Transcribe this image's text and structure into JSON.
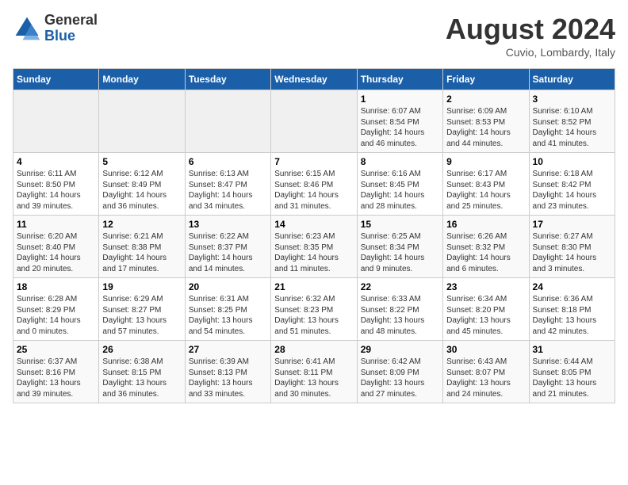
{
  "header": {
    "logo_general": "General",
    "logo_blue": "Blue",
    "month_title": "August 2024",
    "subtitle": "Cuvio, Lombardy, Italy"
  },
  "days_of_week": [
    "Sunday",
    "Monday",
    "Tuesday",
    "Wednesday",
    "Thursday",
    "Friday",
    "Saturday"
  ],
  "weeks": [
    [
      {
        "day": "",
        "info": ""
      },
      {
        "day": "",
        "info": ""
      },
      {
        "day": "",
        "info": ""
      },
      {
        "day": "",
        "info": ""
      },
      {
        "day": "1",
        "info": "Sunrise: 6:07 AM\nSunset: 8:54 PM\nDaylight: 14 hours and 46 minutes."
      },
      {
        "day": "2",
        "info": "Sunrise: 6:09 AM\nSunset: 8:53 PM\nDaylight: 14 hours and 44 minutes."
      },
      {
        "day": "3",
        "info": "Sunrise: 6:10 AM\nSunset: 8:52 PM\nDaylight: 14 hours and 41 minutes."
      }
    ],
    [
      {
        "day": "4",
        "info": "Sunrise: 6:11 AM\nSunset: 8:50 PM\nDaylight: 14 hours and 39 minutes."
      },
      {
        "day": "5",
        "info": "Sunrise: 6:12 AM\nSunset: 8:49 PM\nDaylight: 14 hours and 36 minutes."
      },
      {
        "day": "6",
        "info": "Sunrise: 6:13 AM\nSunset: 8:47 PM\nDaylight: 14 hours and 34 minutes."
      },
      {
        "day": "7",
        "info": "Sunrise: 6:15 AM\nSunset: 8:46 PM\nDaylight: 14 hours and 31 minutes."
      },
      {
        "day": "8",
        "info": "Sunrise: 6:16 AM\nSunset: 8:45 PM\nDaylight: 14 hours and 28 minutes."
      },
      {
        "day": "9",
        "info": "Sunrise: 6:17 AM\nSunset: 8:43 PM\nDaylight: 14 hours and 25 minutes."
      },
      {
        "day": "10",
        "info": "Sunrise: 6:18 AM\nSunset: 8:42 PM\nDaylight: 14 hours and 23 minutes."
      }
    ],
    [
      {
        "day": "11",
        "info": "Sunrise: 6:20 AM\nSunset: 8:40 PM\nDaylight: 14 hours and 20 minutes."
      },
      {
        "day": "12",
        "info": "Sunrise: 6:21 AM\nSunset: 8:38 PM\nDaylight: 14 hours and 17 minutes."
      },
      {
        "day": "13",
        "info": "Sunrise: 6:22 AM\nSunset: 8:37 PM\nDaylight: 14 hours and 14 minutes."
      },
      {
        "day": "14",
        "info": "Sunrise: 6:23 AM\nSunset: 8:35 PM\nDaylight: 14 hours and 11 minutes."
      },
      {
        "day": "15",
        "info": "Sunrise: 6:25 AM\nSunset: 8:34 PM\nDaylight: 14 hours and 9 minutes."
      },
      {
        "day": "16",
        "info": "Sunrise: 6:26 AM\nSunset: 8:32 PM\nDaylight: 14 hours and 6 minutes."
      },
      {
        "day": "17",
        "info": "Sunrise: 6:27 AM\nSunset: 8:30 PM\nDaylight: 14 hours and 3 minutes."
      }
    ],
    [
      {
        "day": "18",
        "info": "Sunrise: 6:28 AM\nSunset: 8:29 PM\nDaylight: 14 hours and 0 minutes."
      },
      {
        "day": "19",
        "info": "Sunrise: 6:29 AM\nSunset: 8:27 PM\nDaylight: 13 hours and 57 minutes."
      },
      {
        "day": "20",
        "info": "Sunrise: 6:31 AM\nSunset: 8:25 PM\nDaylight: 13 hours and 54 minutes."
      },
      {
        "day": "21",
        "info": "Sunrise: 6:32 AM\nSunset: 8:23 PM\nDaylight: 13 hours and 51 minutes."
      },
      {
        "day": "22",
        "info": "Sunrise: 6:33 AM\nSunset: 8:22 PM\nDaylight: 13 hours and 48 minutes."
      },
      {
        "day": "23",
        "info": "Sunrise: 6:34 AM\nSunset: 8:20 PM\nDaylight: 13 hours and 45 minutes."
      },
      {
        "day": "24",
        "info": "Sunrise: 6:36 AM\nSunset: 8:18 PM\nDaylight: 13 hours and 42 minutes."
      }
    ],
    [
      {
        "day": "25",
        "info": "Sunrise: 6:37 AM\nSunset: 8:16 PM\nDaylight: 13 hours and 39 minutes."
      },
      {
        "day": "26",
        "info": "Sunrise: 6:38 AM\nSunset: 8:15 PM\nDaylight: 13 hours and 36 minutes."
      },
      {
        "day": "27",
        "info": "Sunrise: 6:39 AM\nSunset: 8:13 PM\nDaylight: 13 hours and 33 minutes."
      },
      {
        "day": "28",
        "info": "Sunrise: 6:41 AM\nSunset: 8:11 PM\nDaylight: 13 hours and 30 minutes."
      },
      {
        "day": "29",
        "info": "Sunrise: 6:42 AM\nSunset: 8:09 PM\nDaylight: 13 hours and 27 minutes."
      },
      {
        "day": "30",
        "info": "Sunrise: 6:43 AM\nSunset: 8:07 PM\nDaylight: 13 hours and 24 minutes."
      },
      {
        "day": "31",
        "info": "Sunrise: 6:44 AM\nSunset: 8:05 PM\nDaylight: 13 hours and 21 minutes."
      }
    ]
  ]
}
